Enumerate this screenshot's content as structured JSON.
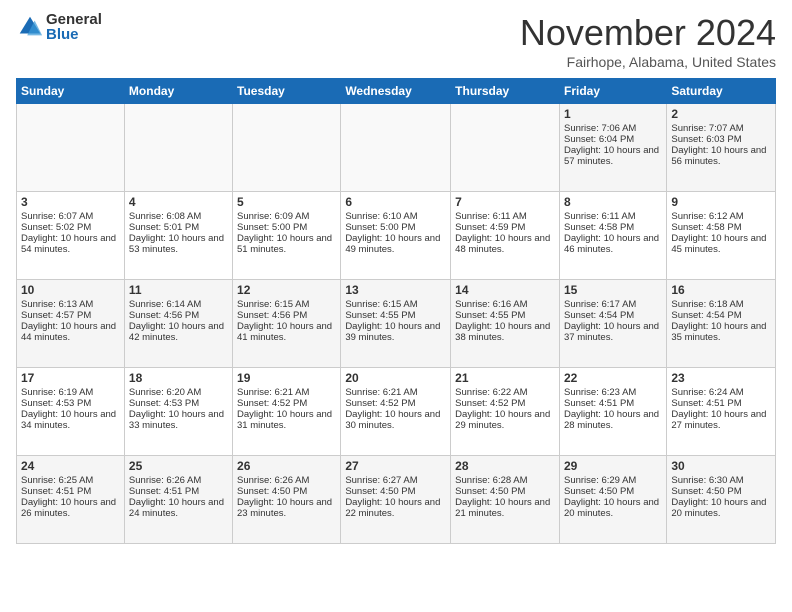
{
  "logo": {
    "general": "General",
    "blue": "Blue"
  },
  "header": {
    "month": "November 2024",
    "location": "Fairhope, Alabama, United States"
  },
  "weekdays": [
    "Sunday",
    "Monday",
    "Tuesday",
    "Wednesday",
    "Thursday",
    "Friday",
    "Saturday"
  ],
  "weeks": [
    [
      {
        "day": "",
        "empty": true
      },
      {
        "day": "",
        "empty": true
      },
      {
        "day": "",
        "empty": true
      },
      {
        "day": "",
        "empty": true
      },
      {
        "day": "",
        "empty": true
      },
      {
        "day": "1",
        "sunrise": "7:06 AM",
        "sunset": "6:04 PM",
        "daylight": "10 hours and 57 minutes."
      },
      {
        "day": "2",
        "sunrise": "7:07 AM",
        "sunset": "6:03 PM",
        "daylight": "10 hours and 56 minutes."
      }
    ],
    [
      {
        "day": "3",
        "sunrise": "6:07 AM",
        "sunset": "5:02 PM",
        "daylight": "10 hours and 54 minutes."
      },
      {
        "day": "4",
        "sunrise": "6:08 AM",
        "sunset": "5:01 PM",
        "daylight": "10 hours and 53 minutes."
      },
      {
        "day": "5",
        "sunrise": "6:09 AM",
        "sunset": "5:00 PM",
        "daylight": "10 hours and 51 minutes."
      },
      {
        "day": "6",
        "sunrise": "6:10 AM",
        "sunset": "5:00 PM",
        "daylight": "10 hours and 49 minutes."
      },
      {
        "day": "7",
        "sunrise": "6:11 AM",
        "sunset": "4:59 PM",
        "daylight": "10 hours and 48 minutes."
      },
      {
        "day": "8",
        "sunrise": "6:11 AM",
        "sunset": "4:58 PM",
        "daylight": "10 hours and 46 minutes."
      },
      {
        "day": "9",
        "sunrise": "6:12 AM",
        "sunset": "4:58 PM",
        "daylight": "10 hours and 45 minutes."
      }
    ],
    [
      {
        "day": "10",
        "sunrise": "6:13 AM",
        "sunset": "4:57 PM",
        "daylight": "10 hours and 44 minutes."
      },
      {
        "day": "11",
        "sunrise": "6:14 AM",
        "sunset": "4:56 PM",
        "daylight": "10 hours and 42 minutes."
      },
      {
        "day": "12",
        "sunrise": "6:15 AM",
        "sunset": "4:56 PM",
        "daylight": "10 hours and 41 minutes."
      },
      {
        "day": "13",
        "sunrise": "6:15 AM",
        "sunset": "4:55 PM",
        "daylight": "10 hours and 39 minutes."
      },
      {
        "day": "14",
        "sunrise": "6:16 AM",
        "sunset": "4:55 PM",
        "daylight": "10 hours and 38 minutes."
      },
      {
        "day": "15",
        "sunrise": "6:17 AM",
        "sunset": "4:54 PM",
        "daylight": "10 hours and 37 minutes."
      },
      {
        "day": "16",
        "sunrise": "6:18 AM",
        "sunset": "4:54 PM",
        "daylight": "10 hours and 35 minutes."
      }
    ],
    [
      {
        "day": "17",
        "sunrise": "6:19 AM",
        "sunset": "4:53 PM",
        "daylight": "10 hours and 34 minutes."
      },
      {
        "day": "18",
        "sunrise": "6:20 AM",
        "sunset": "4:53 PM",
        "daylight": "10 hours and 33 minutes."
      },
      {
        "day": "19",
        "sunrise": "6:21 AM",
        "sunset": "4:52 PM",
        "daylight": "10 hours and 31 minutes."
      },
      {
        "day": "20",
        "sunrise": "6:21 AM",
        "sunset": "4:52 PM",
        "daylight": "10 hours and 30 minutes."
      },
      {
        "day": "21",
        "sunrise": "6:22 AM",
        "sunset": "4:52 PM",
        "daylight": "10 hours and 29 minutes."
      },
      {
        "day": "22",
        "sunrise": "6:23 AM",
        "sunset": "4:51 PM",
        "daylight": "10 hours and 28 minutes."
      },
      {
        "day": "23",
        "sunrise": "6:24 AM",
        "sunset": "4:51 PM",
        "daylight": "10 hours and 27 minutes."
      }
    ],
    [
      {
        "day": "24",
        "sunrise": "6:25 AM",
        "sunset": "4:51 PM",
        "daylight": "10 hours and 26 minutes."
      },
      {
        "day": "25",
        "sunrise": "6:26 AM",
        "sunset": "4:51 PM",
        "daylight": "10 hours and 24 minutes."
      },
      {
        "day": "26",
        "sunrise": "6:26 AM",
        "sunset": "4:50 PM",
        "daylight": "10 hours and 23 minutes."
      },
      {
        "day": "27",
        "sunrise": "6:27 AM",
        "sunset": "4:50 PM",
        "daylight": "10 hours and 22 minutes."
      },
      {
        "day": "28",
        "sunrise": "6:28 AM",
        "sunset": "4:50 PM",
        "daylight": "10 hours and 21 minutes."
      },
      {
        "day": "29",
        "sunrise": "6:29 AM",
        "sunset": "4:50 PM",
        "daylight": "10 hours and 20 minutes."
      },
      {
        "day": "30",
        "sunrise": "6:30 AM",
        "sunset": "4:50 PM",
        "daylight": "10 hours and 20 minutes."
      }
    ]
  ]
}
